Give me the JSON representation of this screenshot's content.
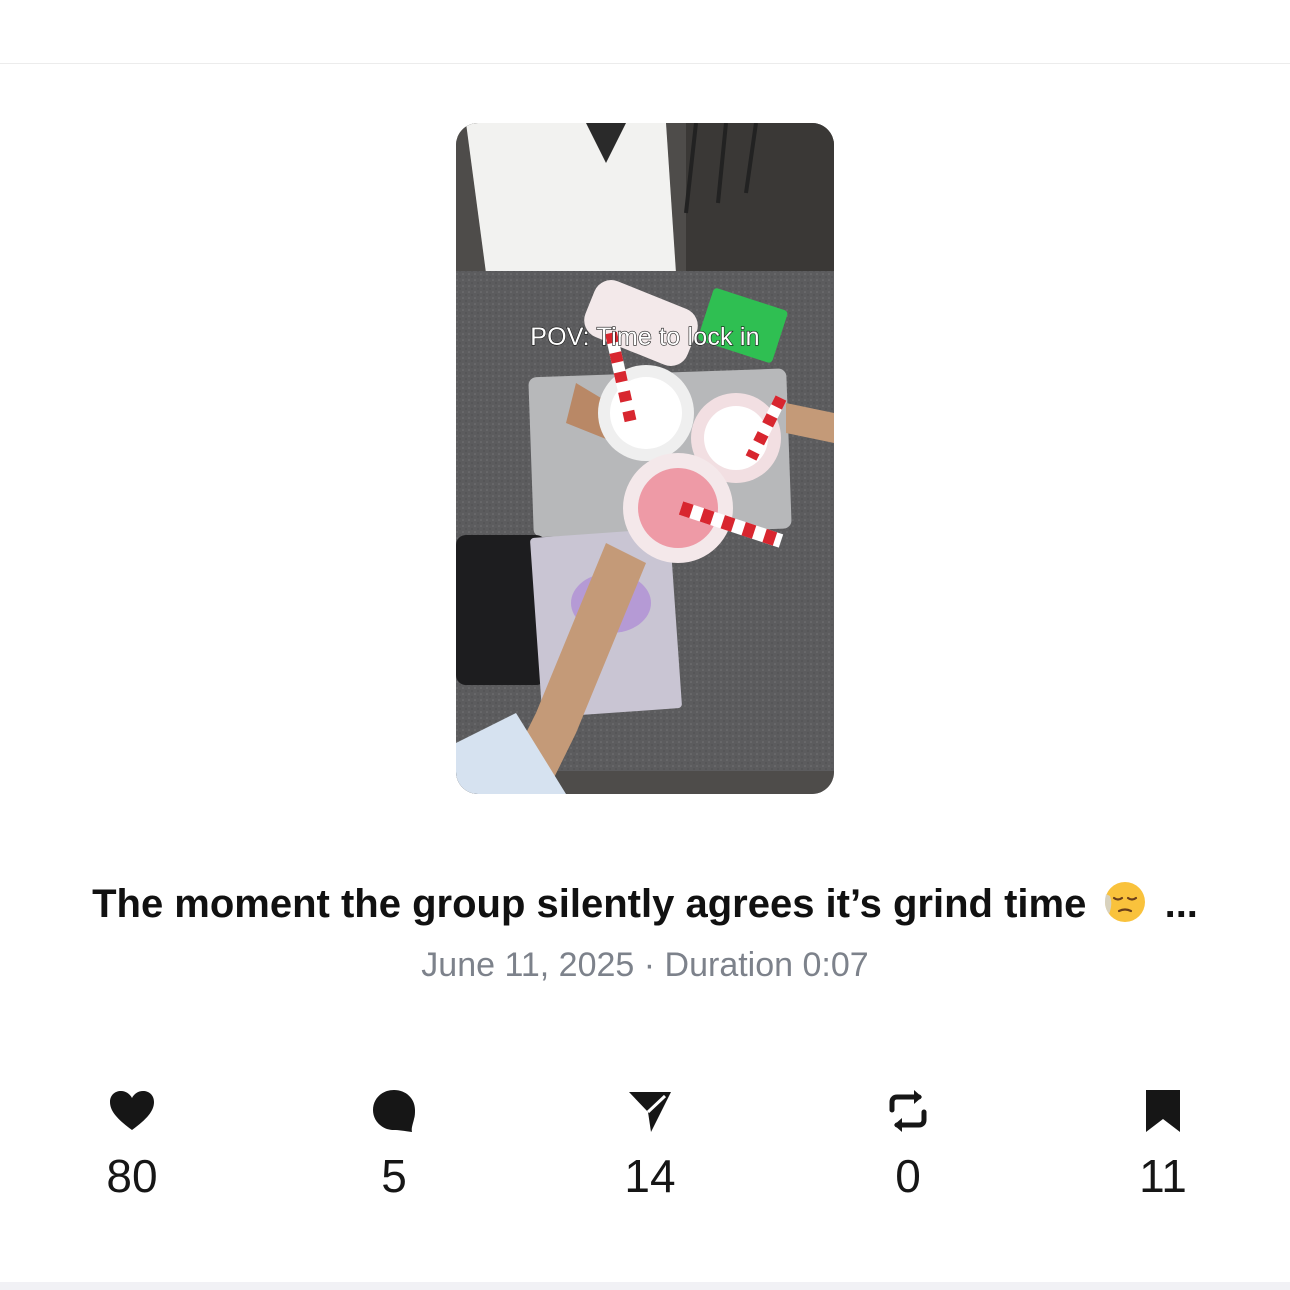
{
  "video": {
    "overlay_caption": "POV: Time to lock in"
  },
  "post": {
    "title": "The moment the group silently agrees it’s grind time",
    "title_emoji": "pensive-face-emoji",
    "title_ellipsis": "...",
    "date": "June 11, 2025",
    "separator": "·",
    "duration_label": "Duration",
    "duration": "0:07"
  },
  "stats": [
    {
      "icon": "heart-icon",
      "value": "80"
    },
    {
      "icon": "comment-icon",
      "value": "5"
    },
    {
      "icon": "share-icon",
      "value": "14"
    },
    {
      "icon": "repost-icon",
      "value": "0"
    },
    {
      "icon": "bookmark-icon",
      "value": "11"
    }
  ],
  "colors": {
    "text_primary": "#111111",
    "text_secondary": "#7d828b",
    "icon": "#161616",
    "divider": "#f1f1f5"
  }
}
